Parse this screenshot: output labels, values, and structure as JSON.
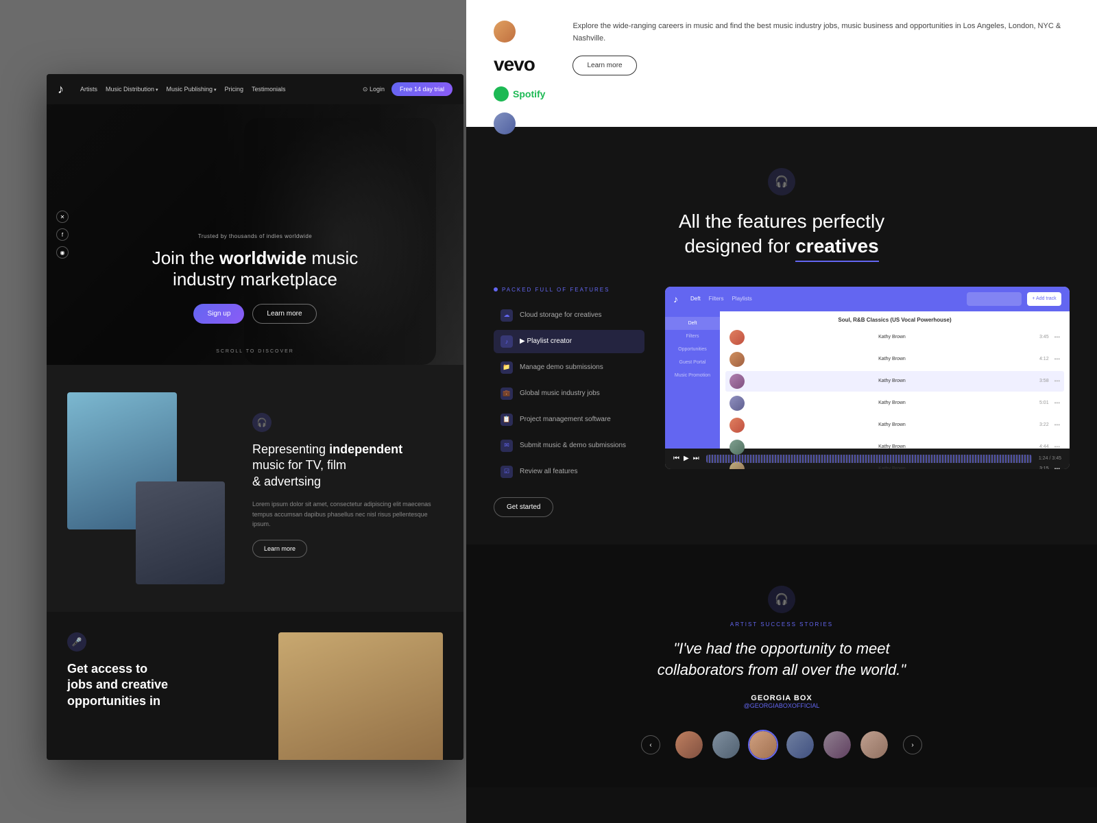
{
  "left_panel": {
    "nav": {
      "logo": "♪",
      "links": [
        "Artists",
        "Music Distribution",
        "Music Publishing",
        "Pricing",
        "Testimonials"
      ],
      "has_arrow": [
        false,
        true,
        true,
        false,
        false
      ],
      "login": "Login",
      "trial_button": "Free 14 day trial"
    },
    "hero": {
      "trusted_text": "Trusted by thousands of indies worldwide",
      "title_line1": "Join the",
      "title_bold": "worldwide",
      "title_line2": "music industry marketplace",
      "signup_button": "Sign up",
      "learn_button": "Learn more",
      "scroll_text": "SCROLL TO DISCOVER"
    },
    "represent": {
      "title_pre": "Representing",
      "title_bold": "independent",
      "title_post": "music for TV, film & advertsing",
      "description": "Lorem ipsum dolor sit amet, consectetur adipiscing elit maecenas tempus accumsan dapibus phasellus nec nisl risus pellentesque ipsum.",
      "button": "Learn more"
    },
    "jobs": {
      "title_pre": "Get access to jobs and",
      "title_bold": "creative opportunities in"
    }
  },
  "right_panel": {
    "top": {
      "description": "Explore the wide-ranging careers in music and find the best music industry jobs, music business and opportunities in Los Angeles, London, NYC & Nashville.",
      "button": "Learn more",
      "vevo": "vevo",
      "spotify": "Spotify"
    },
    "features": {
      "icon": "🎧",
      "title_pre": "All the features perfectly designed for",
      "title_bold": "creatives",
      "packed_label": "PACKED FULL OF FEATURES",
      "items": [
        "Cloud storage for creatives",
        "Playlist creator",
        "Manage demo submissions",
        "Global music industry jobs",
        "Project management software",
        "Submit music & demo submissions",
        "Review all features"
      ],
      "active_index": 1,
      "get_started": "Get started"
    },
    "app_mockup": {
      "logo": "♪",
      "nav_items": [
        "Deft",
        "Filters",
        "Playlists",
        "Opportunities",
        "Guest Portal",
        "Music Promotion"
      ],
      "track_title": "Soul, R&B Classics (US Vocal Powerhouse)",
      "tracks": [
        "Kathy Brown",
        "Kathy Brown",
        "Kathy Brown",
        "Kathy Brown",
        "Kathy Brown",
        "Kathy Brown",
        "Kathy Brown"
      ]
    },
    "testimonials": {
      "label": "ARTIST SUCCESS STORIES",
      "quote": "\"I've had the opportunity to meet collaborators from all over the world.\"",
      "author_name": "GEORGIA BOX",
      "author_handle": "@GEORGIABOXOFFICIAL",
      "prev": "‹",
      "next": "›"
    }
  }
}
